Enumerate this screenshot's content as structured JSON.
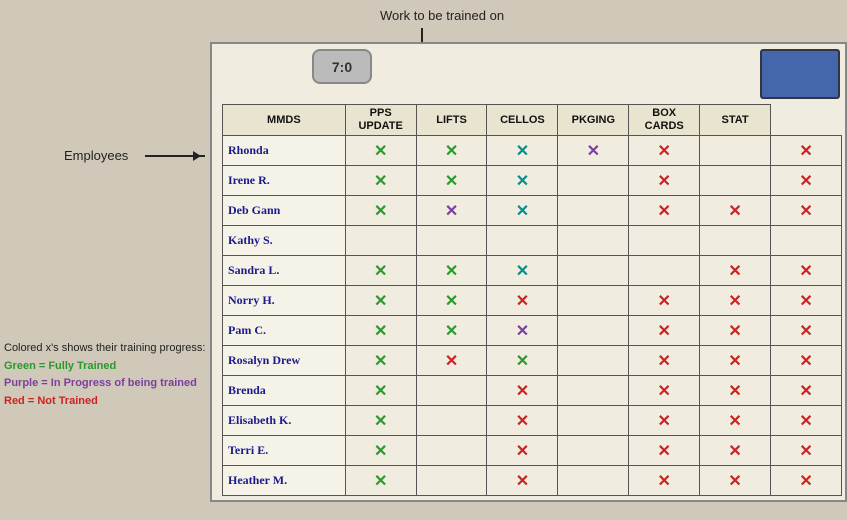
{
  "annotations": {
    "top_label": "Work to be trained on",
    "employees_label": "Employees",
    "legend_title": "Colored x's shows their training progress:",
    "legend_green": "Green = Fully Trained",
    "legend_purple": "Purple = In Progress of being trained",
    "legend_red": "Red = Not Trained"
  },
  "table": {
    "headers": [
      "MMDS",
      "PPS UPDATE",
      "LIFTS",
      "CELLOS",
      "PKGING",
      "BOX CARDS",
      "STAT"
    ],
    "rows": [
      {
        "name": "Rhonda",
        "cells": [
          "green",
          "green",
          "teal",
          "purple",
          "red",
          "",
          "red"
        ]
      },
      {
        "name": "Irene R.",
        "cells": [
          "green",
          "green",
          "teal",
          "",
          "red",
          "",
          "red"
        ]
      },
      {
        "name": "Deb Gann",
        "cells": [
          "green",
          "purple",
          "teal",
          "",
          "red",
          "red",
          "red"
        ]
      },
      {
        "name": "Kathy S.",
        "cells": [
          "",
          "",
          "",
          "",
          "",
          "",
          ""
        ]
      },
      {
        "name": "Sandra L.",
        "cells": [
          "green",
          "green",
          "teal",
          "",
          "",
          "red",
          "red"
        ]
      },
      {
        "name": "Norry H.",
        "cells": [
          "green",
          "green",
          "red",
          "",
          "red",
          "red",
          "red"
        ]
      },
      {
        "name": "Pam C.",
        "cells": [
          "green",
          "green",
          "purple",
          "",
          "red",
          "red",
          "red"
        ]
      },
      {
        "name": "Rosalyn Drew",
        "cells": [
          "green",
          "red",
          "green",
          "",
          "red",
          "red",
          "red"
        ]
      },
      {
        "name": "Brenda",
        "cells": [
          "green",
          "",
          "red",
          "",
          "red",
          "red",
          "red"
        ]
      },
      {
        "name": "Elisabeth K.",
        "cells": [
          "green",
          "",
          "red",
          "",
          "red",
          "red",
          "red"
        ]
      },
      {
        "name": "Terri E.",
        "cells": [
          "green",
          "",
          "red",
          "",
          "red",
          "red",
          "red"
        ]
      },
      {
        "name": "Heather M.",
        "cells": [
          "green",
          "",
          "red",
          "",
          "red",
          "red",
          "red"
        ]
      }
    ]
  }
}
